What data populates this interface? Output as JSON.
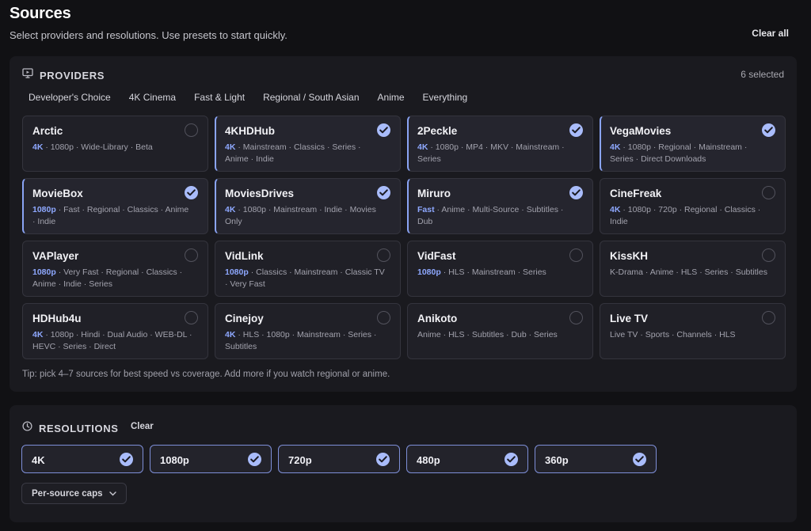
{
  "header": {
    "title": "Sources",
    "subtitle": "Select providers and resolutions. Use presets to start quickly.",
    "clear_all": "Clear all"
  },
  "providers": {
    "title": "PROVIDERS",
    "icon": "monitor-icon",
    "selected_count": "6 selected",
    "presets": [
      "Developer's Choice",
      "4K Cinema",
      "Fast & Light",
      "Regional / South Asian",
      "Anime",
      "Everything"
    ],
    "cards": [
      {
        "name": "Arctic",
        "highlight": "4K",
        "meta": " · 1080p · Wide-Library · Beta",
        "selected": false
      },
      {
        "name": "4KHDHub",
        "highlight": "4K",
        "meta": " · Mainstream · Classics · Series · Anime · Indie",
        "selected": true
      },
      {
        "name": "2Peckle",
        "highlight": "4K",
        "meta": " · 1080p · MP4 · MKV · Mainstream · Series",
        "selected": true
      },
      {
        "name": "VegaMovies",
        "highlight": "4K",
        "meta": " · 1080p · Regional · Mainstream · Series · Direct Downloads",
        "selected": true
      },
      {
        "name": "MovieBox",
        "highlight": "1080p",
        "meta": " · Fast · Regional · Classics · Anime · Indie",
        "selected": true
      },
      {
        "name": "MoviesDrives",
        "highlight": "4K",
        "meta": " · 1080p · Mainstream · Indie · Movies Only",
        "selected": true
      },
      {
        "name": "Miruro",
        "highlight": "Fast",
        "meta": " · Anime · Multi-Source · Subtitles · Dub",
        "selected": true
      },
      {
        "name": "CineFreak",
        "highlight": "4K",
        "meta": " · 1080p · 720p · Regional · Classics · Indie",
        "selected": false
      },
      {
        "name": "VAPlayer",
        "highlight": "1080p",
        "meta": " · Very Fast · Regional · Classics · Anime · Indie · Series",
        "selected": false
      },
      {
        "name": "VidLink",
        "highlight": "1080p",
        "meta": " · Classics · Mainstream · Classic TV · Very Fast",
        "selected": false
      },
      {
        "name": "VidFast",
        "highlight": "1080p",
        "meta": " · HLS · Mainstream · Series",
        "selected": false
      },
      {
        "name": "KissKH",
        "highlight": "",
        "meta": "K-Drama · Anime · HLS · Series · Subtitles",
        "selected": false
      },
      {
        "name": "HDHub4u",
        "highlight": "4K",
        "meta": " · 1080p · Hindi · Dual Audio · WEB-DL · HEVC · Series · Direct",
        "selected": false
      },
      {
        "name": "Cinejoy",
        "highlight": "4K",
        "meta": " · HLS · 1080p · Mainstream · Series · Subtitles",
        "selected": false
      },
      {
        "name": "Anikoto",
        "highlight": "",
        "meta": "Anime · HLS · Subtitles · Dub · Series",
        "selected": false
      },
      {
        "name": "Live TV",
        "highlight": "",
        "meta": "Live TV · Sports · Channels · HLS",
        "selected": false
      }
    ],
    "tip": "Tip: pick 4–7 sources for best speed vs coverage. Add more if you watch regional or anime."
  },
  "resolutions": {
    "title": "RESOLUTIONS",
    "icon": "clock-icon",
    "clear": "Clear",
    "options": [
      {
        "label": "4K",
        "selected": true
      },
      {
        "label": "1080p",
        "selected": true
      },
      {
        "label": "720p",
        "selected": true
      },
      {
        "label": "480p",
        "selected": true
      },
      {
        "label": "360p",
        "selected": true
      }
    ],
    "caps_label": "Per-source caps"
  },
  "colors": {
    "accent": "#8ea8ff",
    "check_fill": "#a9bcfb",
    "background": "#111114",
    "panel": "#1a1a1f"
  }
}
